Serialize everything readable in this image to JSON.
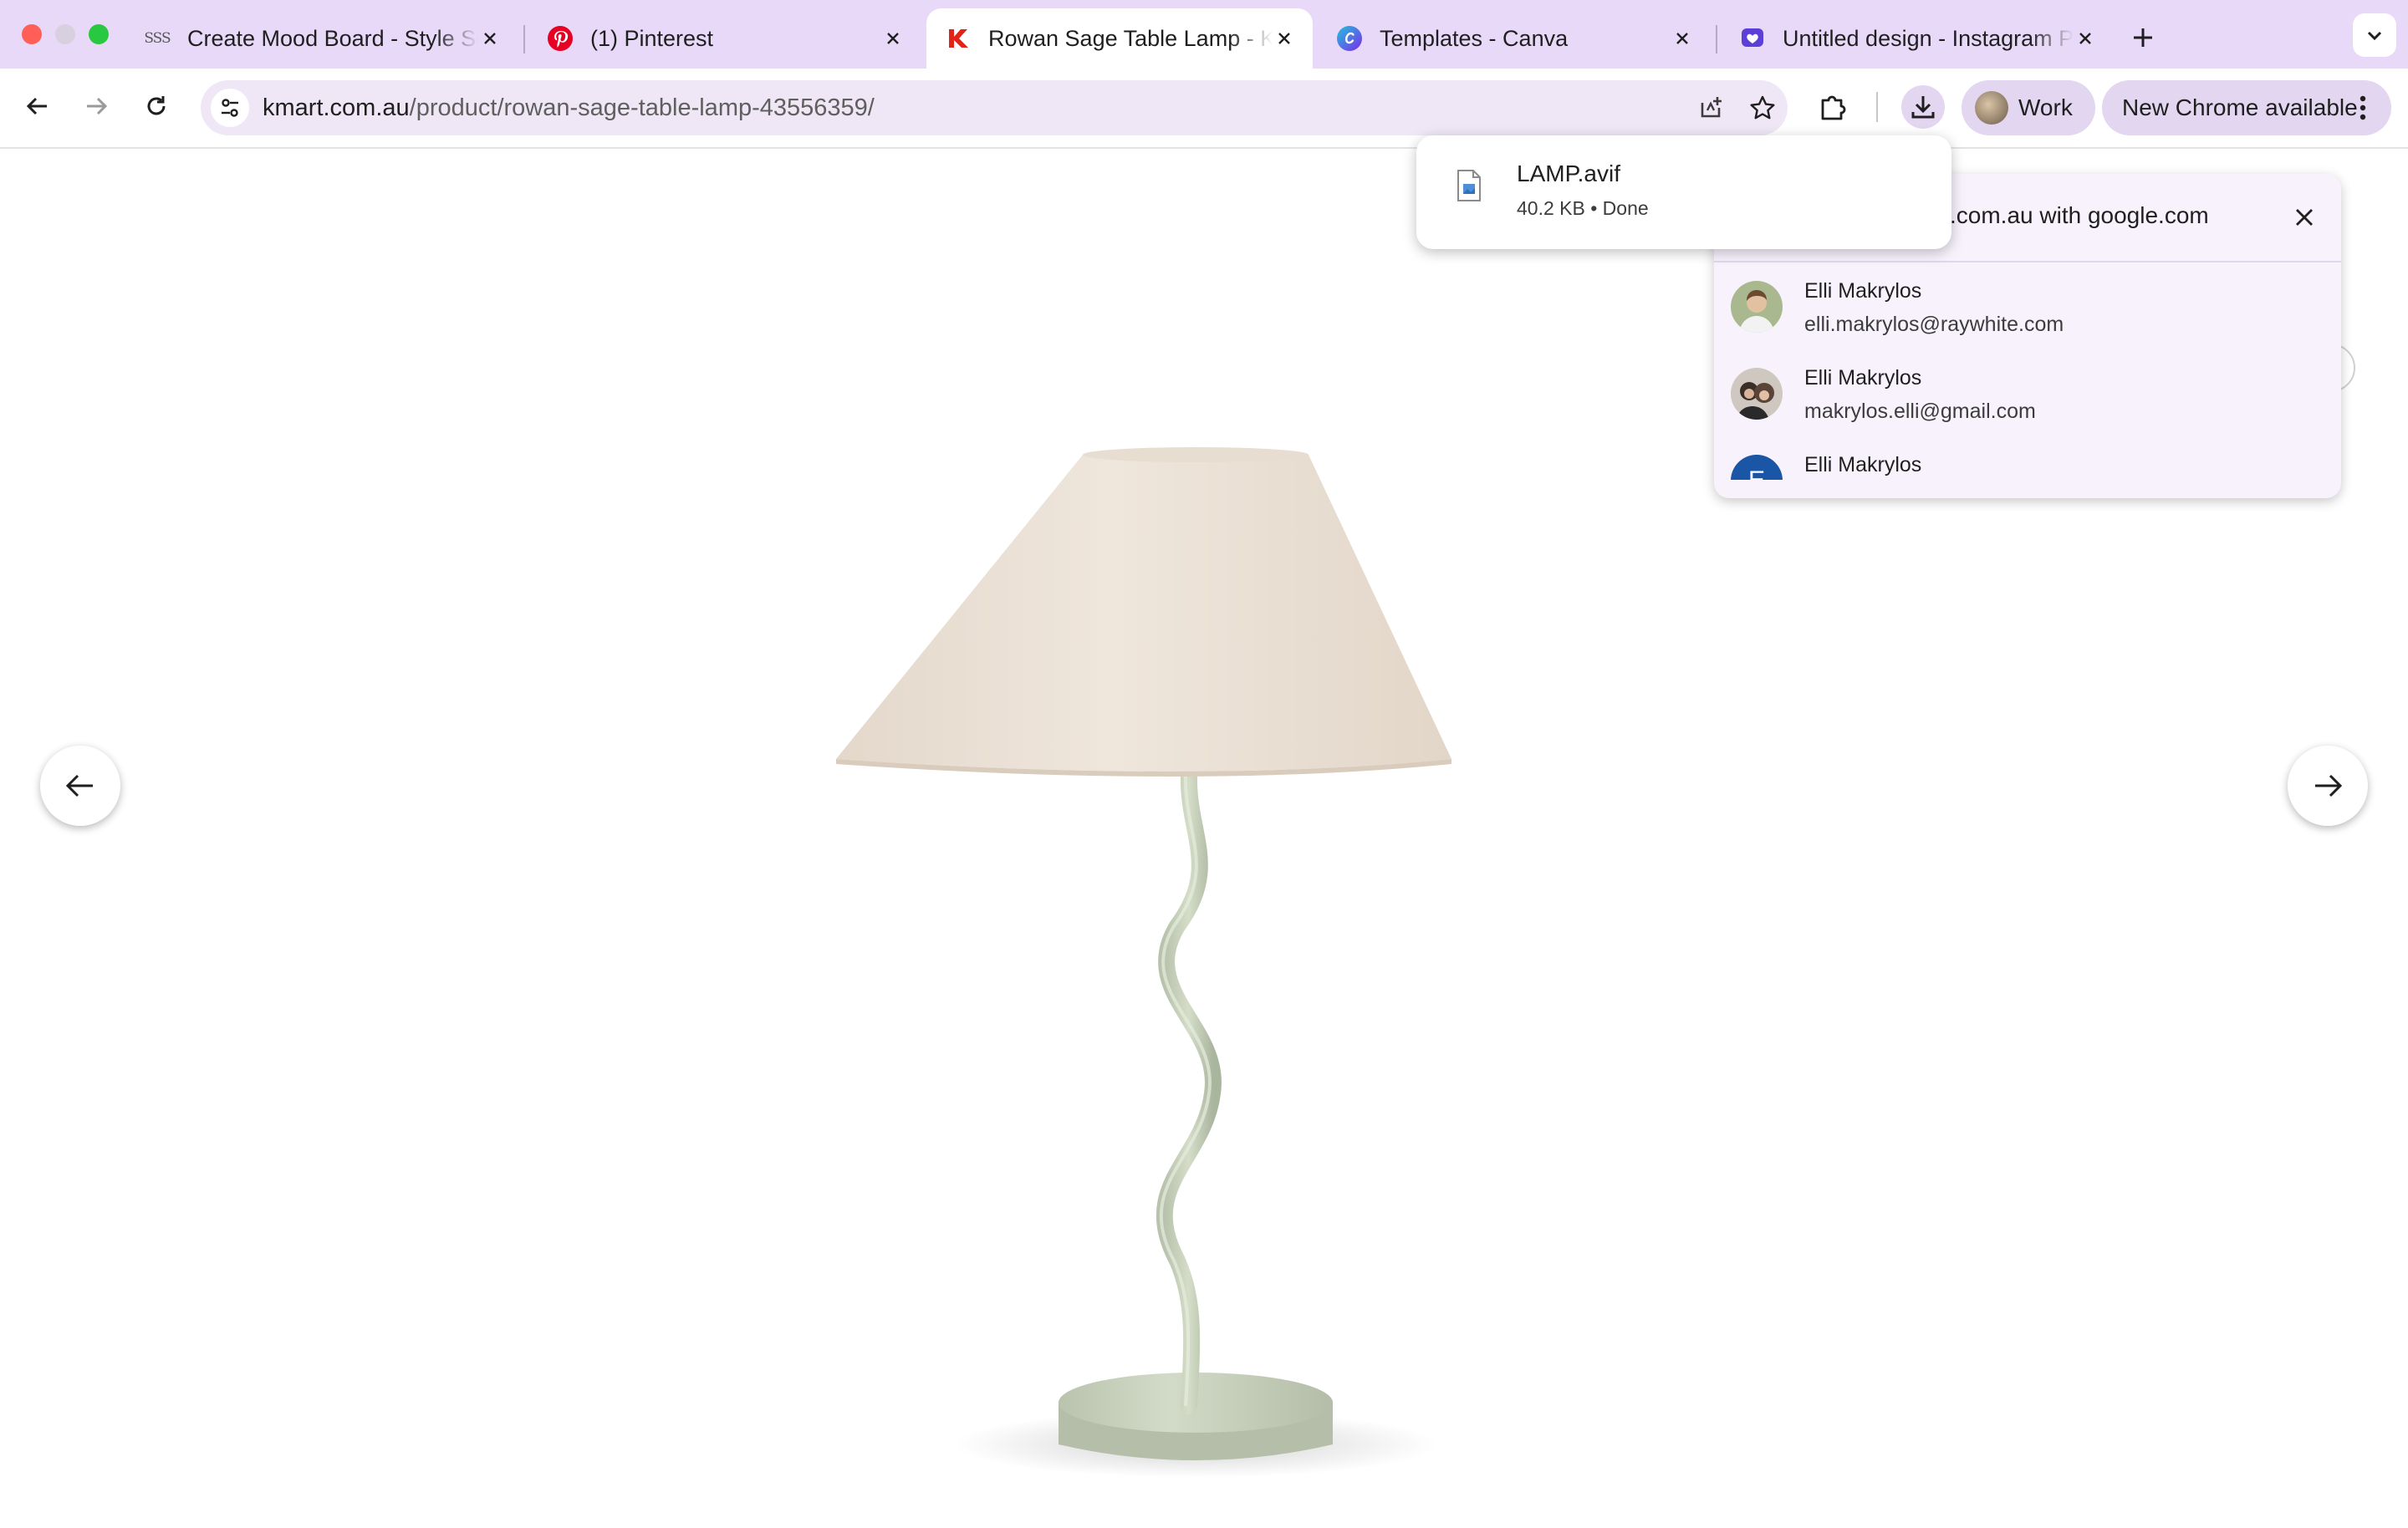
{
  "tabs": [
    {
      "title": "Create Mood Board - Style Sc",
      "icon": "stylesc-logo-icon",
      "active": false
    },
    {
      "title": "(1) Pinterest",
      "icon": "pinterest-icon",
      "active": false
    },
    {
      "title": "Rowan Sage Table Lamp - Km",
      "icon": "kmart-icon",
      "active": true
    },
    {
      "title": "Templates - Canva",
      "icon": "canva-icon",
      "active": false
    },
    {
      "title": "Untitled design - Instagram P",
      "icon": "instagram-design-icon",
      "active": false
    }
  ],
  "favicon_text": {
    "stylesc": "SSS"
  },
  "address_bar": {
    "domain": "kmart.com.au",
    "path": "/product/rowan-sage-table-lamp-43556359/"
  },
  "toolbar": {
    "profile_label": "Work",
    "update_label": "New Chrome available"
  },
  "download": {
    "filename": "LAMP.avif",
    "status": "40.2 KB • Done"
  },
  "signin_popup": {
    "title": ".com.au with google.com",
    "accounts": [
      {
        "name": "Elli Makrylos",
        "email": "elli.makrylos@raywhite.com"
      },
      {
        "name": "Elli Makrylos",
        "email": "makrylos.elli@gmail.com"
      },
      {
        "name": "Elli Makrylos",
        "email": "",
        "initial": "E"
      }
    ]
  },
  "colors": {
    "tabstrip": "#e8d9f8",
    "omnibox": "#efe7f6",
    "chip": "#e2d6f0",
    "lamp_shade": "#ebe0d4",
    "lamp_base": "#cdd6c3",
    "kmart_red": "#e2231a",
    "pinterest_red": "#e60023"
  }
}
